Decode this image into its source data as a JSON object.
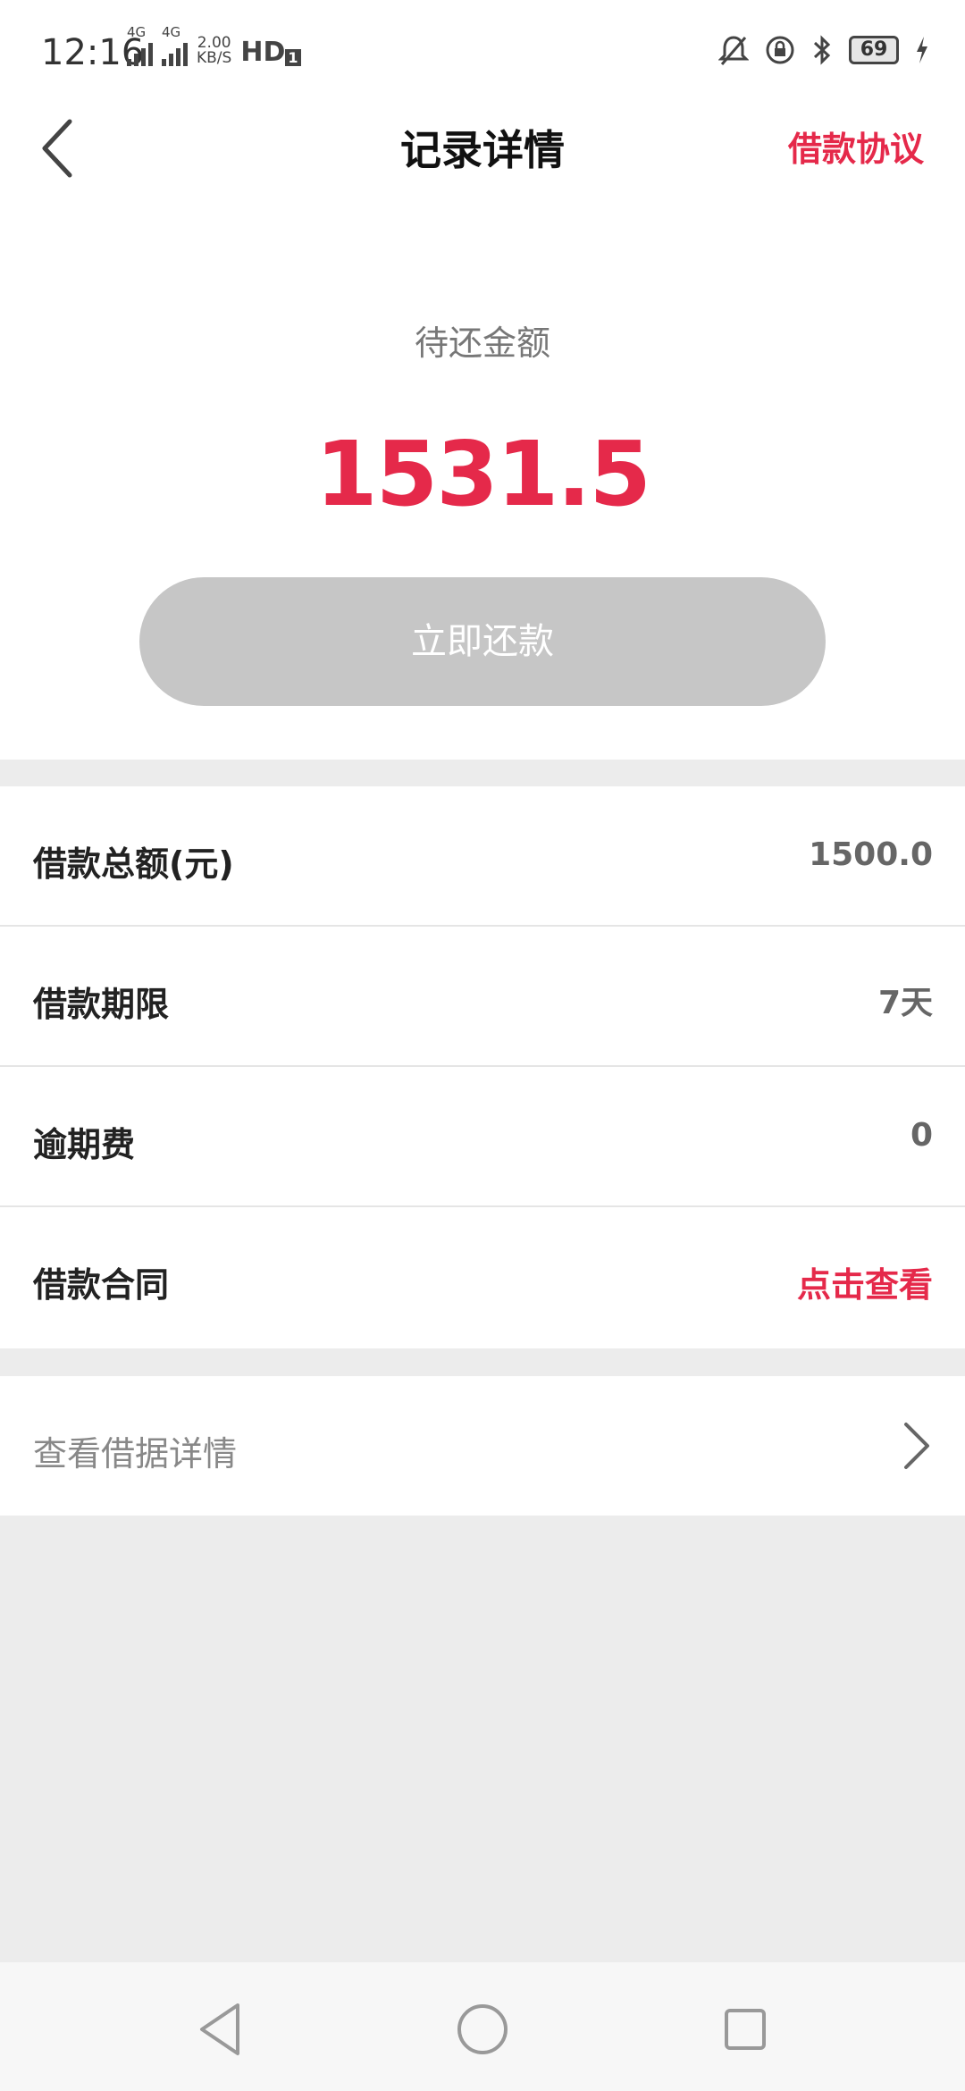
{
  "status_bar": {
    "time": "12:16",
    "network_1": "4G",
    "network_2": "4G",
    "speed_value": "2.00",
    "speed_unit": "KB/S",
    "hd_label": "HD",
    "hd_sim": "1",
    "battery_level": "69"
  },
  "header": {
    "title": "记录详情",
    "agreement_link": "借款协议"
  },
  "summary": {
    "label": "待还金额",
    "amount": "1531.5",
    "repay_button": "立即还款"
  },
  "details": [
    {
      "label": "借款总额(元)",
      "value": "1500.0"
    },
    {
      "label": "借款期限",
      "value": "7天"
    },
    {
      "label": "逾期费",
      "value": "0"
    },
    {
      "label": "借款合同",
      "value": "点击查看"
    }
  ],
  "receipt_link": {
    "label": "查看借据详情"
  },
  "colors": {
    "accent": "#e5294a",
    "button_disabled": "#c6c6c6",
    "page_bg": "#ececec"
  },
  "icons": [
    "back-arrow-icon",
    "chevron-right-icon",
    "nav-back-icon",
    "nav-home-icon",
    "nav-recents-icon",
    "bell-muted-icon",
    "lock-rotation-icon",
    "bluetooth-icon",
    "battery-icon",
    "charging-icon"
  ]
}
